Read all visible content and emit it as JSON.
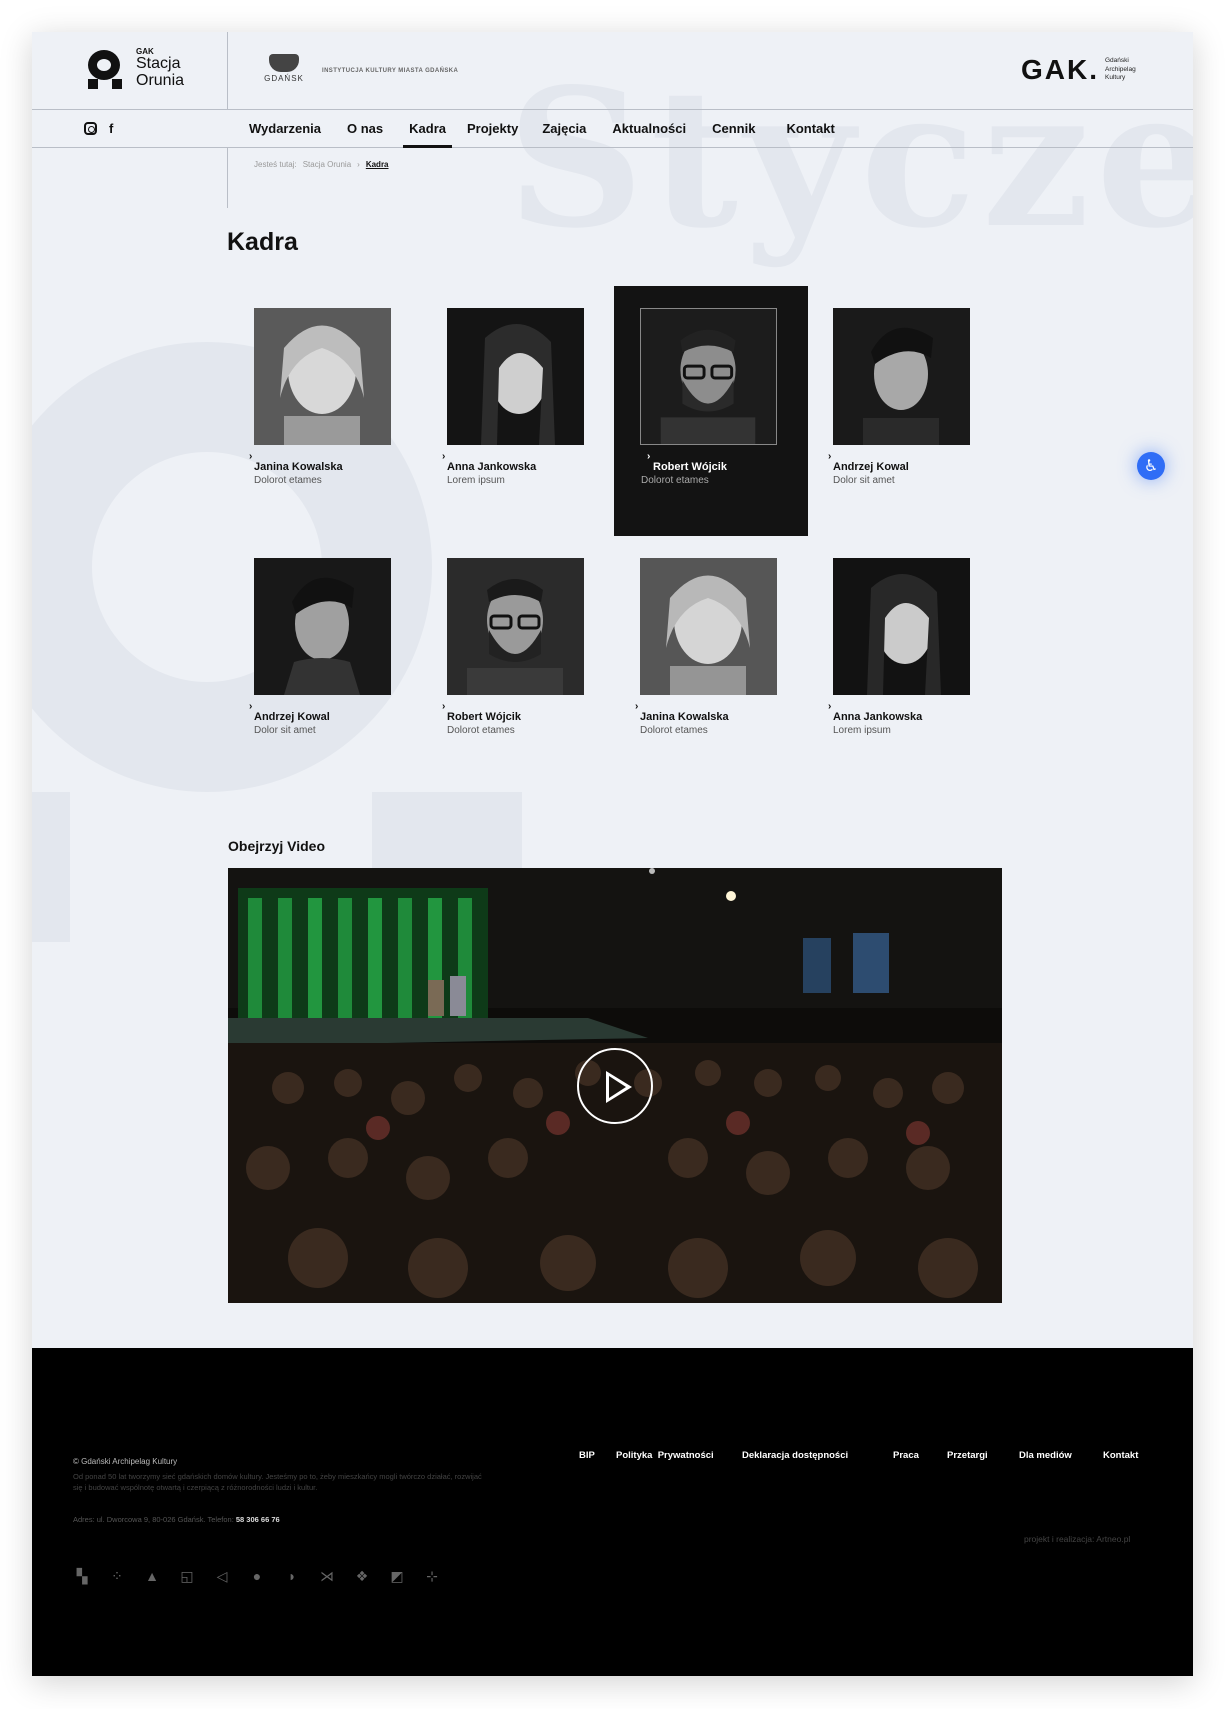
{
  "header": {
    "brand_small": "GAK",
    "brand_line1": "Stacja",
    "brand_line2": "Orunia",
    "city_label": "GDAŃSK",
    "institution_label": "INSTYTUCJA KULTURY MIASTA GDAŃSKA",
    "gak_logo": "GAK.",
    "gak_sub": [
      "Gdański",
      "Archipelag",
      "Kultury"
    ]
  },
  "background_word": "Styczeń",
  "social": [
    {
      "icon": "instagram-icon"
    },
    {
      "icon": "facebook-icon",
      "glyph": "f"
    }
  ],
  "nav": [
    {
      "label": "Wydarzenia",
      "active": false
    },
    {
      "label": "O nas",
      "active": false
    },
    {
      "label": "Kadra",
      "active": true
    },
    {
      "label": "Projekty",
      "active": false
    },
    {
      "label": "Zajęcia",
      "active": false
    },
    {
      "label": "Aktualności",
      "active": false
    },
    {
      "label": "Cennik",
      "active": false
    },
    {
      "label": "Kontakt",
      "active": false
    }
  ],
  "breadcrumb": {
    "prefix": "Jesteś tutaj:",
    "parent": "Stacja Orunia",
    "separator": "›",
    "current": "Kadra"
  },
  "page_title": "Kadra",
  "staff": [
    {
      "name": "Janina Kowalska",
      "role": "Dolorot etames",
      "active": false
    },
    {
      "name": "Anna Jankowska",
      "role": "Lorem ipsum",
      "active": false
    },
    {
      "name": "Robert Wójcik",
      "role": "Dolorot etames",
      "active": true
    },
    {
      "name": "Andrzej Kowal",
      "role": "Dolor sit amet",
      "active": false
    },
    {
      "name": "Andrzej Kowal",
      "role": "Dolor sit amet",
      "active": false
    },
    {
      "name": "Robert Wójcik",
      "role": "Dolorot etames",
      "active": false
    },
    {
      "name": "Janina Kowalska",
      "role": "Dolorot etames",
      "active": false
    },
    {
      "name": "Anna Jankowska",
      "role": "Lorem ipsum",
      "active": false
    }
  ],
  "video": {
    "title": "Obejrzyj Video",
    "play_icon": "play-icon"
  },
  "accessibility_icon": "accessibility-icon",
  "footer": {
    "copyright": "© Gdański Archipelag Kultury",
    "description": "Od ponad 50 lat tworzymy sieć gdańskich domów kultury. Jesteśmy po to, żeby mieszkańcy mogli twórczo działać, rozwijać się i budować wspólnotę otwartą i czerpiącą z różnorodności ludzi i kultur.",
    "address_label": "Adres: ul. Dworcowa 9, 80-026 Gdańsk.  Telefon:",
    "phone": "58 306 66 76",
    "links": [
      "BIP",
      "Polityka  Prywatności",
      "Deklaracja dostępności",
      "Praca",
      "Przetargi",
      "Dla mediów",
      "Kontakt"
    ],
    "credit": "projekt i realizacja: Artneo.pl",
    "branch_icons": [
      "branch-icon-1",
      "branch-icon-2",
      "branch-icon-3",
      "branch-icon-4",
      "branch-icon-5",
      "branch-icon-6",
      "branch-icon-7",
      "branch-icon-8",
      "branch-icon-9",
      "branch-icon-10",
      "branch-icon-11"
    ]
  },
  "colors": {
    "background": "#eef1f6",
    "text": "#111111",
    "footer": "#000000",
    "accent_accessibility": "#2f6df6",
    "video_curtain": "#1f8a3a"
  }
}
